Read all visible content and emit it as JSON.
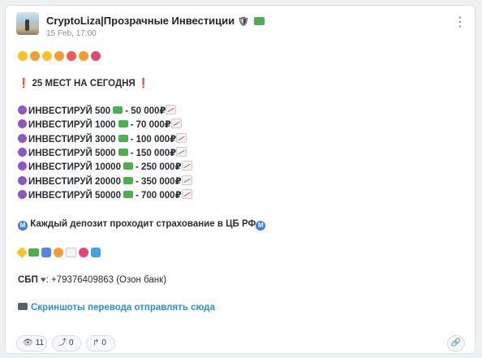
{
  "channel": {
    "title": "CryptoLiza|Прозрачные Инвестиции",
    "shield_icon": "🛡",
    "date": "15 Feb, 17:00",
    "menu_icon": "⋮"
  },
  "post": {
    "headline": "25 МЕСТ НА СЕГОДНЯ",
    "headline_mark": "❗",
    "tiers": [
      {
        "amount": "ИНВЕСТИРУЙ 500",
        "result": "- 50 000₽"
      },
      {
        "amount": "ИНВЕСТИРУЙ 1000",
        "result": "- 70 000₽"
      },
      {
        "amount": "ИНВЕСТИРУЙ 3000",
        "result": "- 100 000₽"
      },
      {
        "amount": "ИНВЕСТИРУЙ 5000",
        "result": "- 150 000₽"
      },
      {
        "amount": "ИНВЕСТИРУЙ 10000",
        "result": "- 250 000₽"
      },
      {
        "amount": "ИНВЕСТИРУЙ 20000",
        "result": "- 350 000₽"
      },
      {
        "amount": "ИНВЕСТИРУЙ 50000",
        "result": "- 700 000₽"
      }
    ],
    "insurance_text": "Каждый депозит проходит страхование в ЦБ РФ",
    "insurance_badge": "M",
    "sbp_label": "СБП",
    "sbp_heart": "♥",
    "sbp_phone": ": +79376409863 (Озон банк)",
    "screenshot_link": "Скриншоты перевода отправлять сюда"
  },
  "footer": {
    "views": "11",
    "shares": "0",
    "forwards": "0",
    "views_icon": "👁",
    "shares_icon": "⤴",
    "forwards_icon": "↱",
    "link_icon": "🔗"
  },
  "colors": {
    "link": "#2b8fd6",
    "accent_purple": "#8e57c9",
    "alert_red": "#e0302d"
  }
}
